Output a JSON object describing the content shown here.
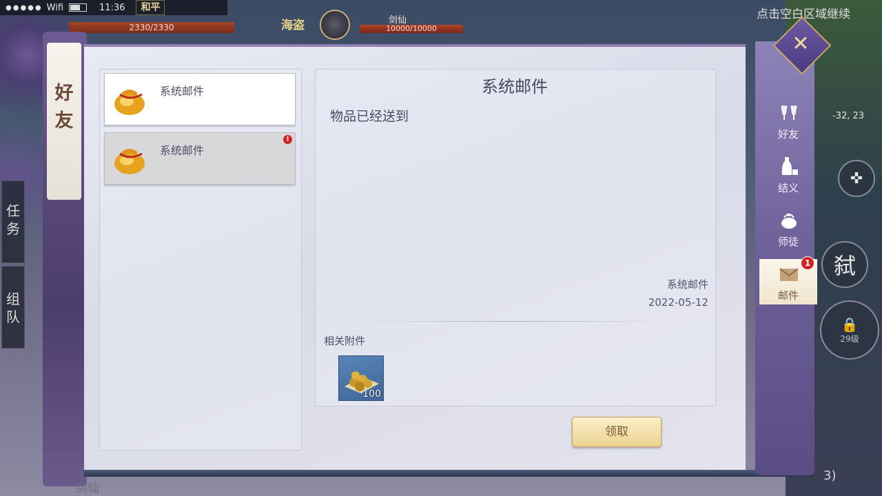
{
  "status_bar": {
    "network": "Wifi",
    "time": "11:36",
    "pk_mode": "和平"
  },
  "player": {
    "hp": "2330/2330"
  },
  "target": {
    "guild_tag": "海盗",
    "name": "剑仙",
    "hp": "10000/10000"
  },
  "hint": "点击空白区域继续",
  "side_tabs": {
    "task": "任务",
    "team": "组队"
  },
  "hud": {
    "coords": "-32, 23",
    "skill_kill": "弑",
    "lock_level": "29级"
  },
  "panel": {
    "title": "好友"
  },
  "mail_list": [
    {
      "title": "系统邮件",
      "unread": false
    },
    {
      "title": "系统邮件",
      "unread": true,
      "badge": "!"
    }
  ],
  "mail_detail": {
    "title": "系统邮件",
    "body": "物品已经送到",
    "sender": "系统邮件",
    "date": "2022-05-12",
    "attachment_label": "相关附件",
    "attachment_qty": "100",
    "claim_label": "领取"
  },
  "right_tabs": [
    {
      "label": "好友",
      "icon": "friends-icon",
      "active": false
    },
    {
      "label": "结义",
      "icon": "brotherhood-icon",
      "active": false
    },
    {
      "label": "师徒",
      "icon": "mentor-icon",
      "active": false
    },
    {
      "label": "邮件",
      "icon": "mail-icon",
      "active": true,
      "badge": "1"
    }
  ],
  "bottom": {
    "name": "剑仙",
    "counter": "3)"
  },
  "colors": {
    "accent_purple": "#6d5f98",
    "badge_red": "#d42222",
    "claim_gold": "#ecd393"
  }
}
